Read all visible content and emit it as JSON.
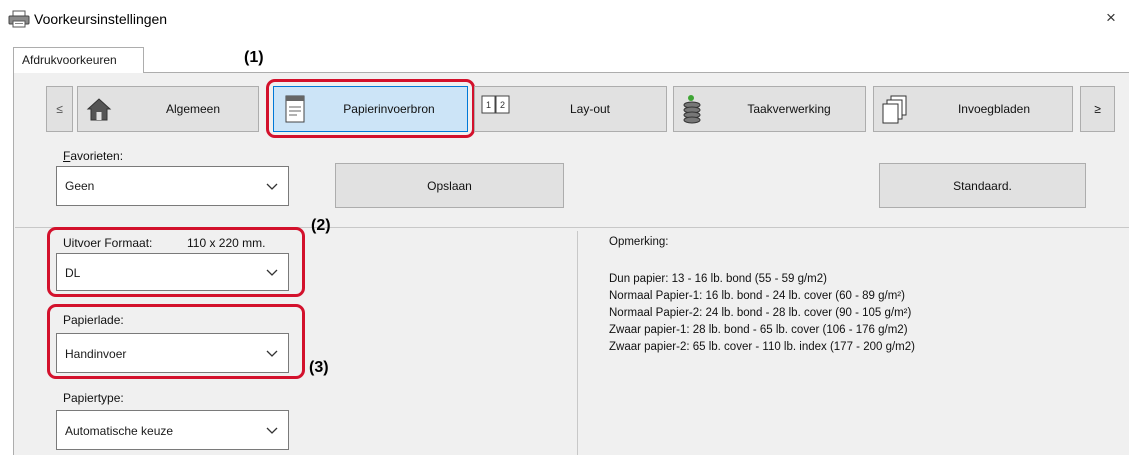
{
  "window": {
    "title": "Voorkeursinstellingen",
    "close_glyph": "×",
    "app_icon": "printer-icon"
  },
  "tabs": [
    {
      "label": "Afdrukvoorkeuren",
      "selected": true
    }
  ],
  "toolbar": {
    "prev_label": "≤",
    "next_label": "≥",
    "buttons": [
      {
        "label": "Algemeen",
        "icon": "home-icon",
        "selected": false
      },
      {
        "label": "Papierinvoerbron",
        "icon": "paper-tray-icon",
        "selected": true
      },
      {
        "label": "Lay-out",
        "icon": "layout-pages-icon",
        "selected": false
      },
      {
        "label": "Taakverwerking",
        "icon": "job-stack-icon",
        "selected": false
      },
      {
        "label": "Invoegbladen",
        "icon": "insert-sheets-icon",
        "selected": false
      }
    ]
  },
  "favorites": {
    "label": "Favorieten:",
    "value": "Geen",
    "save_button": "Opslaan",
    "default_button": "Standaard."
  },
  "output_size": {
    "label": "Uitvoer Formaat:",
    "dimension": "110 x 220 mm.",
    "value": "DL"
  },
  "paper_tray": {
    "label": "Papierlade:",
    "value": "Handinvoer"
  },
  "paper_type": {
    "label": "Papiertype:",
    "value": "Automatische keuze"
  },
  "remark": {
    "heading": "Opmerking:",
    "lines": [
      "Dun papier: 13 - 16 lb. bond (55 - 59 g/m2)",
      "Normaal Papier-1: 16 lb. bond - 24 lb. cover (60 - 89 g/m²)",
      "Normaal Papier-2: 24 lb. bond - 28 lb. cover (90 - 105 g/m²)",
      "Zwaar papier-1: 28 lb. bond - 65 lb. cover (106 - 176 g/m2)",
      "Zwaar papier-2: 65 lb. cover - 110 lb. index (177 - 200 g/m2)"
    ]
  },
  "annotations": [
    "(1)",
    "(2)",
    "(3)"
  ],
  "colors": {
    "highlight": "#d3112c",
    "selected_button": "#cce4f7",
    "panel": "#f0f0f0"
  }
}
